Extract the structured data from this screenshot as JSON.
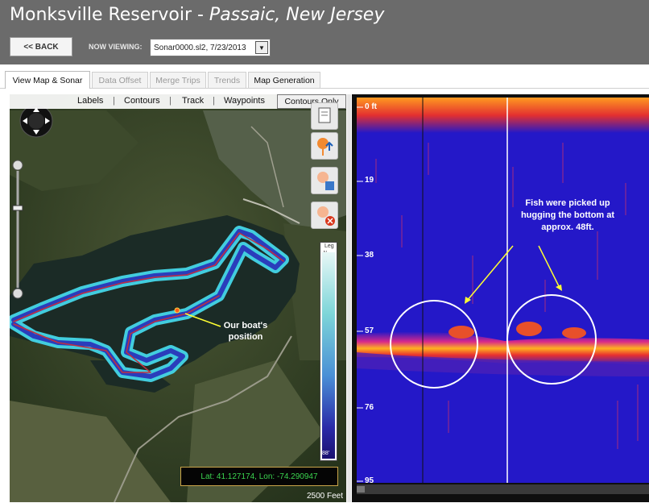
{
  "header": {
    "title_main": "Monksville Reservoir - ",
    "title_italic": "Passaic, New Jersey",
    "back_label": "<< BACK",
    "now_viewing_label": "NOW VIEWING:",
    "now_viewing_value": "Sonar0000.sl2, 7/23/2013"
  },
  "tabs": [
    {
      "label": "View Map & Sonar",
      "active": true
    },
    {
      "label": "Data Offset",
      "active": false
    },
    {
      "label": "Merge Trips",
      "active": false
    },
    {
      "label": "Trends",
      "active": false
    },
    {
      "label": "Map Generation",
      "active": false
    }
  ],
  "map": {
    "layers": [
      "Labels",
      "Contours",
      "Track",
      "Waypoints"
    ],
    "contours_only_label": "Contours Only",
    "depth_top_label": "Leg",
    "depth_min": "1'",
    "depth_max": "88'",
    "latlon": "Lat: 41.127174, Lon: -74.290947",
    "scale": "2500 Feet",
    "annotation": "Our boat's position"
  },
  "sonar": {
    "depth_labels": [
      "0 ft",
      "19",
      "38",
      "57",
      "76",
      "95"
    ],
    "annotation": "Fish were picked up hugging the bottom at approx. 48ft."
  },
  "colors": {
    "titlebar": "#6b6b6b",
    "sonar_background": "#2418c8",
    "bottom_echo": "#ff8a10",
    "track_outline": "#45d6e6",
    "track_line": "#2438b8"
  }
}
